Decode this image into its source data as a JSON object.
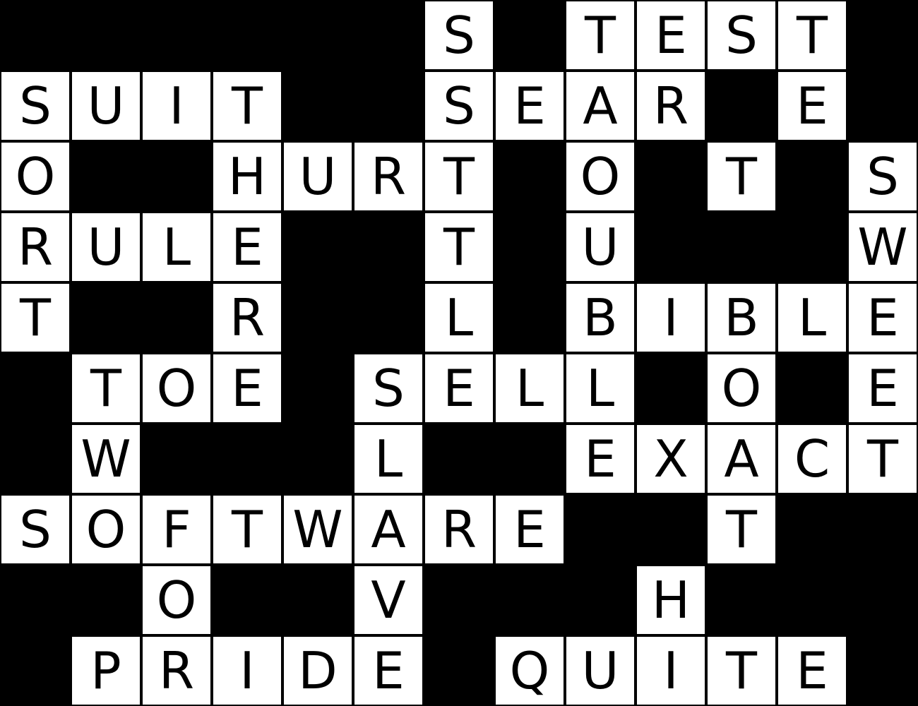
{
  "puzzle": {
    "colors": {
      "block": "#000000",
      "cell": "#ffffff",
      "letter": "#000000"
    },
    "grid": [
      "######S#TEST#",
      "SUIT##SEAR#E##",
      "O##HURT#O#T#S",
      "RULE##T#U###W",
      "T##R##L#BIBLE",
      "#TOE#SELL#O#E",
      "#W###L##EXACT",
      "SOFTWARE##T##",
      "##O##V###H###",
      "#PRIDE#QUITE#"
    ]
  }
}
